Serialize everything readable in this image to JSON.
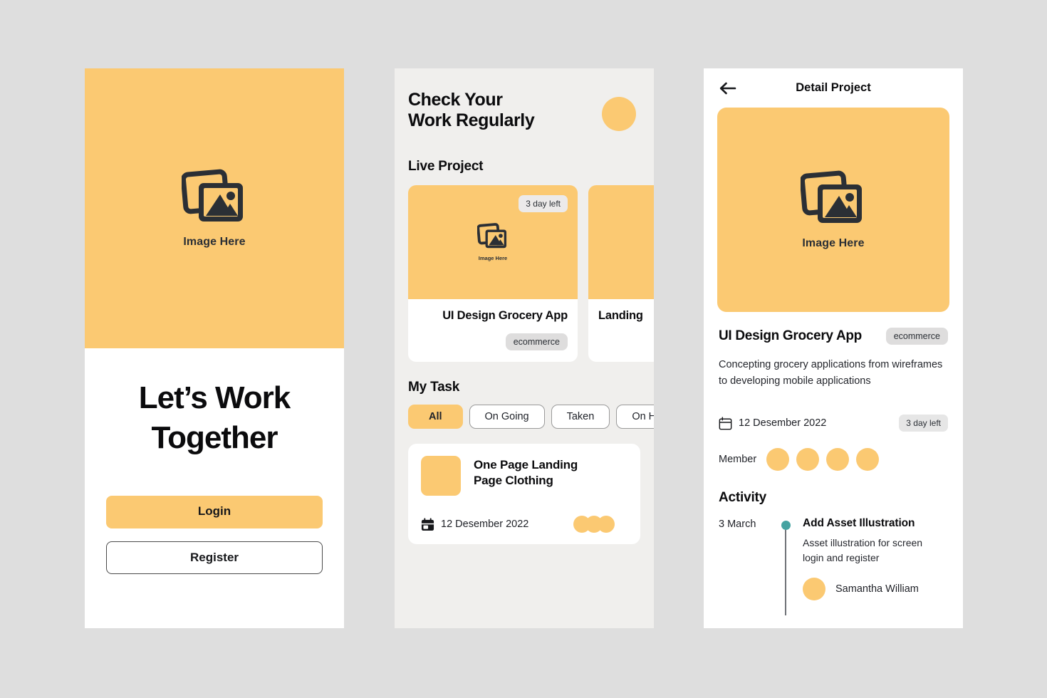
{
  "canvas": {
    "background_color": "#dedede",
    "accent_color": "#fbc972",
    "teal_color": "#45a3a1",
    "chip_gray": "#dedddd"
  },
  "screen_onboarding": {
    "hero": {
      "image_label": "Image Here",
      "icon": "image-placeholder-icon"
    },
    "title": "Let’s Work\nTogether",
    "login_label": "Login",
    "register_label": "Register"
  },
  "screen_dashboard": {
    "heading": "Check Your\nWork Regularly",
    "avatar": "user-avatar",
    "live_project_label": "Live Project",
    "projects": [
      {
        "name": "UI Design Grocery App",
        "tag": "ecommerce",
        "days_left": "3 day left",
        "thumb_label": "Image Here"
      },
      {
        "name": "Landing",
        "tag": "",
        "days_left": "",
        "thumb_label": ""
      }
    ],
    "my_task_label": "My Task",
    "filters": [
      {
        "label": "All",
        "active": true
      },
      {
        "label": "On Going",
        "active": false
      },
      {
        "label": "Taken",
        "active": false
      },
      {
        "label": "On Hold",
        "active": false
      }
    ],
    "task": {
      "name": "One Page Landing\nPage Clothing",
      "date": "12 Desember 2022",
      "avatar_count": 3
    }
  },
  "screen_detail": {
    "back_icon": "arrow-left-icon",
    "topbar_title": "Detail Project",
    "hero": {
      "image_label": "Image Here",
      "icon": "image-placeholder-icon"
    },
    "project_title": "UI Design Grocery App",
    "project_tag": "ecommerce",
    "description": "Concepting grocery applications from wireframes to developing mobile applications",
    "date": "12 Desember 2022",
    "days_left": "3 day left",
    "member_label": "Member",
    "member_count": 4,
    "activity_label": "Activity",
    "activity": [
      {
        "date": "3 March",
        "title": "Add Asset Illustration",
        "detail": "Asset illustration for screen\nlogin and register",
        "user": "Samantha William"
      }
    ]
  }
}
